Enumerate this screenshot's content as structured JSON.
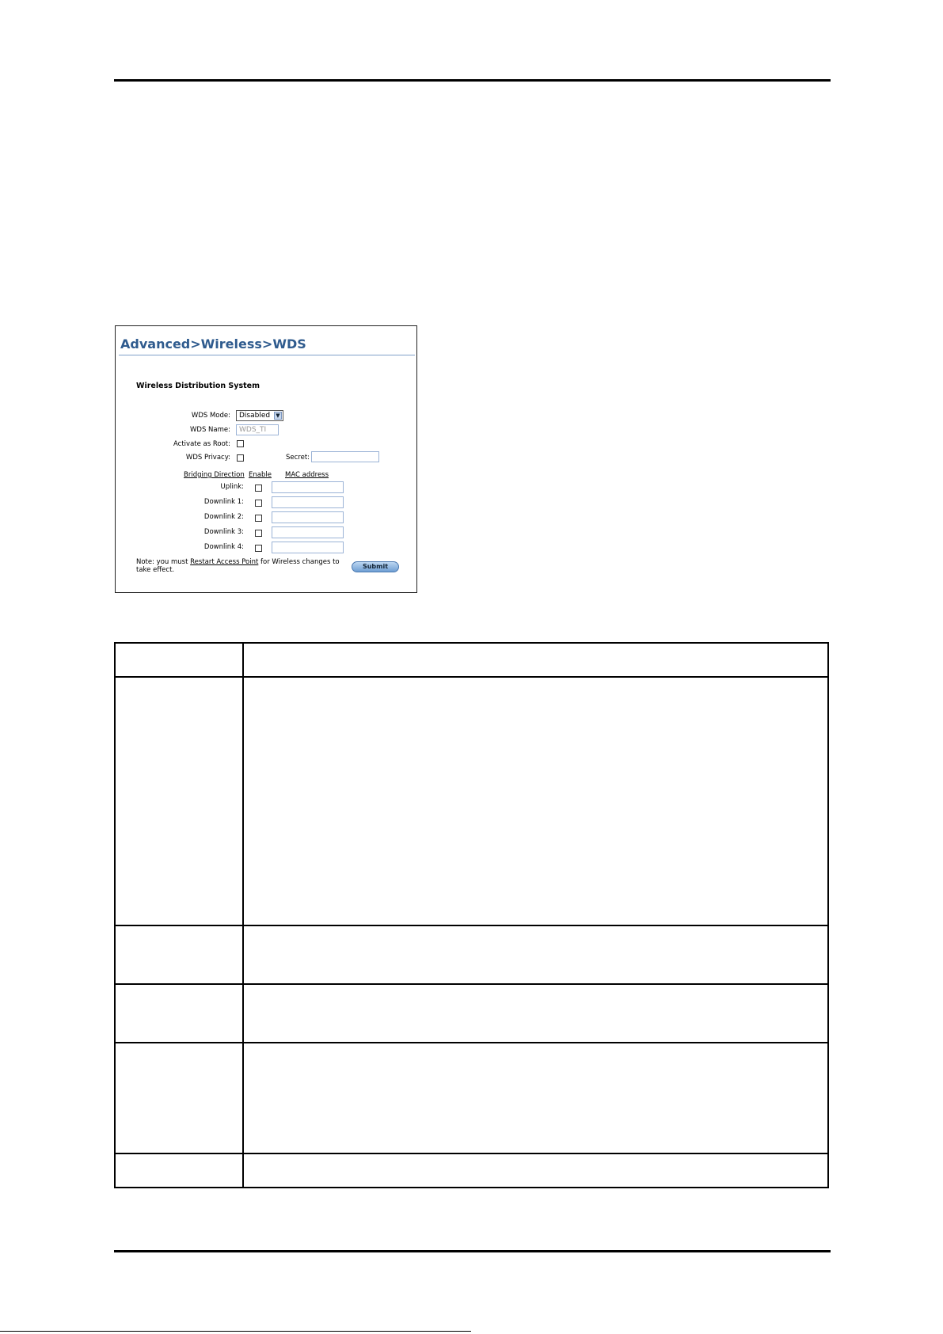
{
  "screenshot": {
    "title": "Advanced>Wireless>WDS",
    "subtitle": "Wireless Distribution System",
    "wds_mode": {
      "label": "WDS Mode:",
      "value": "Disabled"
    },
    "wds_name": {
      "label": "WDS Name:",
      "value": "WDS_TI"
    },
    "activate_root": {
      "label": "Activate as Root:"
    },
    "wds_privacy": {
      "label": "WDS Privacy:"
    },
    "secret": {
      "label": "Secret:",
      "value": ""
    },
    "columns": [
      "Bridging Direction",
      "Enable",
      "MAC address"
    ],
    "links": [
      {
        "label": "Uplink:"
      },
      {
        "label": "Downlink 1:"
      },
      {
        "label": "Downlink 2:"
      },
      {
        "label": "Downlink 3:"
      },
      {
        "label": "Downlink 4:"
      }
    ],
    "note_prefix": "Note: you must ",
    "note_link": "Restart Access Point",
    "note_suffix": " for Wireless changes to take effect.",
    "submit_label": "Submit"
  }
}
